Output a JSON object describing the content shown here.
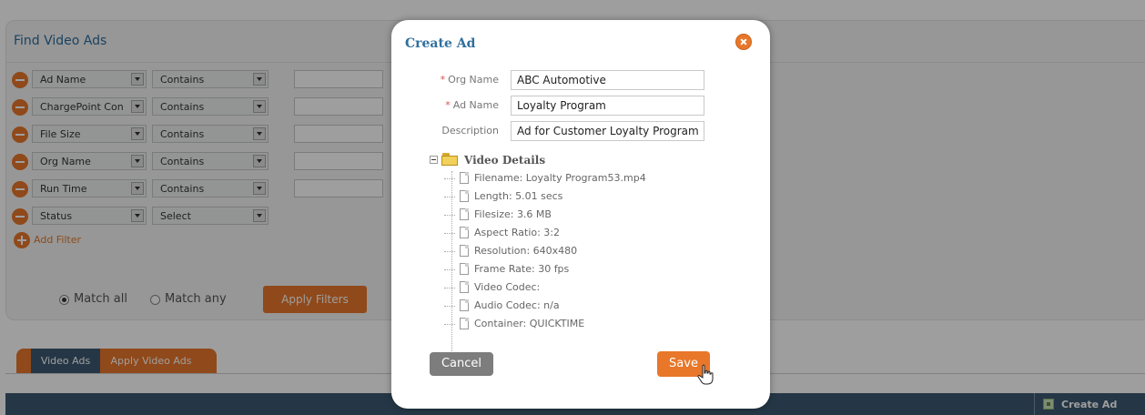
{
  "filter_panel": {
    "title": "Find Video Ads",
    "rows": [
      {
        "field": "Ad Name",
        "operator": "Contains",
        "value": ""
      },
      {
        "field": "ChargePoint Con",
        "operator": "Contains",
        "value": ""
      },
      {
        "field": "File Size",
        "operator": "Contains",
        "value": ""
      },
      {
        "field": "Org Name",
        "operator": "Contains",
        "value": ""
      },
      {
        "field": "Run Time",
        "operator": "Contains",
        "value": ""
      },
      {
        "field": "Status",
        "operator": "Select"
      }
    ],
    "add_filter_label": "Add Filter",
    "match_all_label": "Match all",
    "match_any_label": "Match any",
    "match_selected": "all",
    "apply_label": "Apply Filters"
  },
  "tabs": [
    {
      "label": "Video Ads"
    },
    {
      "label": "Apply Video Ads"
    }
  ],
  "grid": {
    "create_ad_label": "Create Ad"
  },
  "modal": {
    "title": "Create Ad",
    "fields": {
      "org_name": {
        "label": "Org Name",
        "required": true,
        "value": "ABC Automotive"
      },
      "ad_name": {
        "label": "Ad Name",
        "required": true,
        "value": "Loyalty Program"
      },
      "description": {
        "label": "Description",
        "required": false,
        "value": "Ad for Customer Loyalty Program"
      }
    },
    "tree": {
      "root_label": "Video Details",
      "items": [
        "Filename: Loyalty Program53.mp4",
        "Length: 5.01 secs",
        "Filesize: 3.6 MB",
        "Aspect Ratio: 3:2",
        "Resolution: 640x480",
        "Frame Rate: 30 fps",
        "Video Codec:",
        "Audio Codec: n/a",
        "Container: QUICKTIME"
      ]
    },
    "cancel_label": "Cancel",
    "save_label": "Save"
  },
  "colors": {
    "accent": "#e8772a",
    "title_blue": "#2f6f9e",
    "tab_navy": "#3d5a72"
  }
}
